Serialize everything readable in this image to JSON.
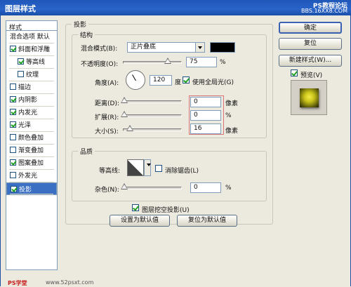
{
  "window": {
    "title": "图层样式"
  },
  "watermark": {
    "top_line1": "PS教程论坛",
    "top_line2": "BBS.16XX8.COM",
    "bottom_left": "PS学堂",
    "bottom_mid": "www.52psxt.com"
  },
  "sidebar": {
    "header": "样式",
    "items": [
      {
        "label": "混合选项 默认",
        "has_checkbox": false,
        "checked": false
      },
      {
        "label": "斜面和浮雕",
        "has_checkbox": true,
        "checked": true
      },
      {
        "label": "等高线",
        "has_checkbox": true,
        "checked": true
      },
      {
        "label": "纹理",
        "has_checkbox": true,
        "checked": false
      },
      {
        "label": "描边",
        "has_checkbox": true,
        "checked": false
      },
      {
        "label": "内阴影",
        "has_checkbox": true,
        "checked": true
      },
      {
        "label": "内发光",
        "has_checkbox": true,
        "checked": true
      },
      {
        "label": "光泽",
        "has_checkbox": true,
        "checked": true
      },
      {
        "label": "颜色叠加",
        "has_checkbox": true,
        "checked": false
      },
      {
        "label": "渐变叠加",
        "has_checkbox": true,
        "checked": false
      },
      {
        "label": "图案叠加",
        "has_checkbox": true,
        "checked": true
      },
      {
        "label": "外发光",
        "has_checkbox": true,
        "checked": false
      },
      {
        "label": "投影",
        "has_checkbox": true,
        "checked": true,
        "selected": true
      }
    ]
  },
  "panel": {
    "title": "投影",
    "structure": {
      "legend": "结构",
      "blend_mode_label": "混合模式(B):",
      "blend_mode_value": "正片叠底",
      "color_swatch": "#000000",
      "opacity_label": "不透明度(O):",
      "opacity_value": "75",
      "opacity_unit": "%",
      "angle_label": "角度(A):",
      "angle_value": "120",
      "angle_unit": "度",
      "global_light_label": "使用全局光(G)",
      "global_light_checked": true,
      "distance_label": "距离(D):",
      "distance_value": "0",
      "distance_unit": "像素",
      "spread_label": "扩展(R):",
      "spread_value": "0",
      "spread_unit": "%",
      "size_label": "大小(S):",
      "size_value": "16",
      "size_unit": "像素"
    },
    "quality": {
      "legend": "品质",
      "contour_label": "等高线:",
      "anti_alias_label": "消除锯齿(L)",
      "anti_alias_checked": false,
      "noise_label": "杂色(N):",
      "noise_value": "0",
      "noise_unit": "%"
    },
    "knockout_label": "图层挖空投影(U)",
    "knockout_checked": true,
    "set_default_label": "设置为默认值",
    "reset_default_label": "复位为默认值"
  },
  "buttons": {
    "ok": "确定",
    "reset": "复位",
    "new_style": "新建样式(W)...",
    "preview_label": "预览(V)",
    "preview_checked": true
  },
  "colors": {
    "preview_accent": "#c8c21a",
    "selection": "#3b6fc4"
  }
}
